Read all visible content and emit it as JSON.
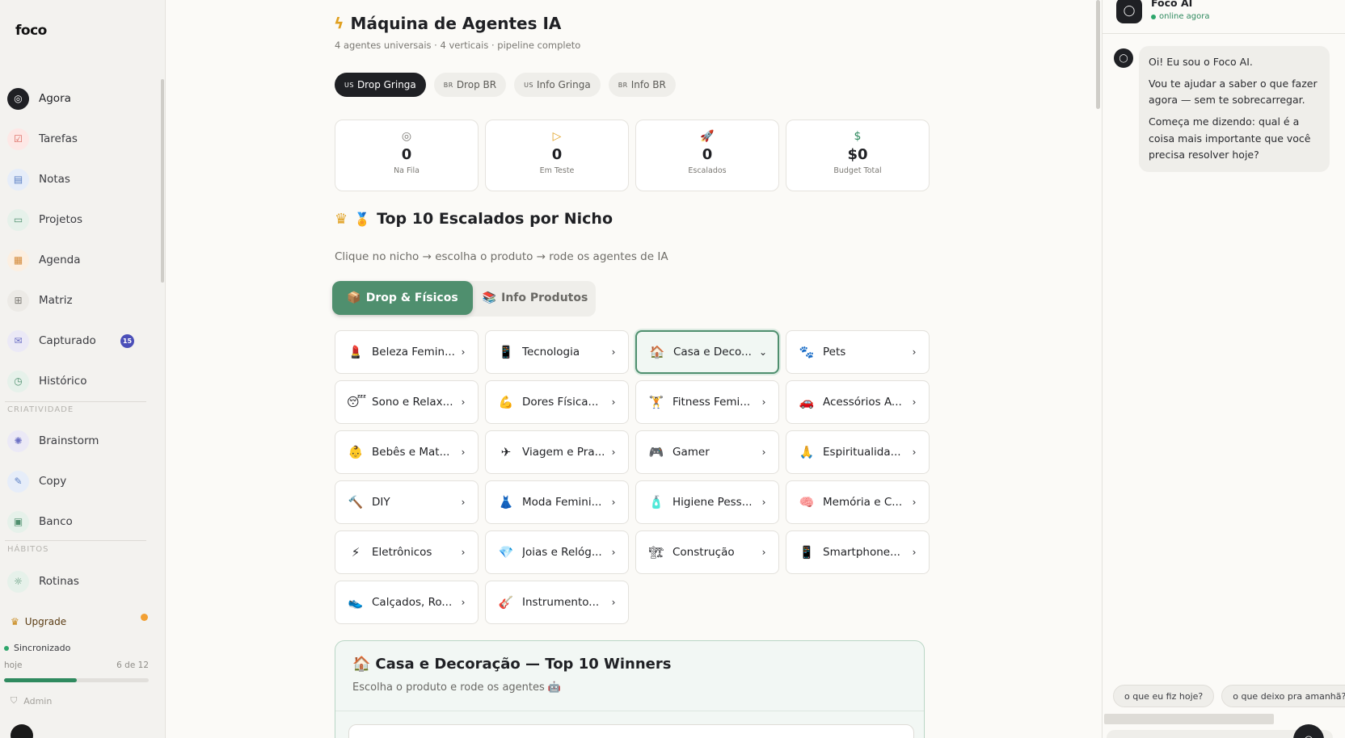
{
  "app": {
    "logo_text": "foco"
  },
  "sidebar": {
    "items": [
      {
        "label": "Agora",
        "icon": "◎",
        "icon_name": "target-icon",
        "bg": "#1f2024",
        "color": "#ffffff",
        "active": true
      },
      {
        "label": "Tarefas",
        "icon": "☑",
        "icon_name": "checkbox-icon",
        "bg": "#fde8e6",
        "color": "#d9645a"
      },
      {
        "label": "Notas",
        "icon": "▤",
        "icon_name": "note-icon",
        "bg": "#e6edf9",
        "color": "#5b7fc4"
      },
      {
        "label": "Projetos",
        "icon": "▭",
        "icon_name": "folder-icon",
        "bg": "#e6f1ea",
        "color": "#4f8f6e"
      },
      {
        "label": "Agenda",
        "icon": "▦",
        "icon_name": "calendar-icon",
        "bg": "#fcefe1",
        "color": "#d48a3a"
      },
      {
        "label": "Matriz",
        "icon": "⊞",
        "icon_name": "grid-icon",
        "bg": "#eceae6",
        "color": "#7a7873"
      },
      {
        "label": "Capturado",
        "icon": "✉",
        "icon_name": "inbox-icon",
        "bg": "#ebe9f6",
        "color": "#6b6fc4",
        "badge": "15"
      },
      {
        "label": "Histórico",
        "icon": "◷",
        "icon_name": "clock-icon",
        "bg": "#e6f1ea",
        "color": "#4f8f6e"
      }
    ],
    "criatividade_label": "CRIATIVIDADE",
    "criatividade_items": [
      {
        "label": "Brainstorm",
        "icon": "✺",
        "icon_name": "sparkle-icon",
        "bg": "#ebe9f6",
        "color": "#6b6fc4"
      },
      {
        "label": "Copy",
        "icon": "✎",
        "icon_name": "pen-icon",
        "bg": "#e6edf9",
        "color": "#5b7fc4"
      },
      {
        "label": "Banco",
        "icon": "▣",
        "icon_name": "archive-icon",
        "bg": "#e6f1ea",
        "color": "#4f8f6e"
      }
    ],
    "habitos_label": "HÁBITOS",
    "habitos_items": [
      {
        "label": "Rotinas",
        "icon": "☼",
        "icon_name": "sun-icon",
        "bg": "#e6f1ea",
        "color": "#4f8f6e"
      }
    ],
    "upgrade_label": "Upgrade",
    "sync_label": "Sincronizado",
    "progress_left": "hoje",
    "progress_right": "6 de 12",
    "progress_fraction": 0.5,
    "admin_label": "Admin"
  },
  "main": {
    "title": "Máquina de Agentes IA",
    "subtitle": "4 agentes universais · 4 verticais · pipeline completo",
    "pills": [
      {
        "code": "US",
        "label": "Drop Gringa",
        "active": true
      },
      {
        "code": "BR",
        "label": "Drop BR"
      },
      {
        "code": "US",
        "label": "Info Gringa"
      },
      {
        "code": "BR",
        "label": "Info BR"
      }
    ],
    "stats": [
      {
        "icon": "◎",
        "icon_name": "target-icon",
        "color": "#7a7873",
        "value": "0",
        "label": "Na Fila"
      },
      {
        "icon": "▷",
        "icon_name": "play-icon",
        "color": "#e0a020",
        "value": "0",
        "label": "Em Teste"
      },
      {
        "icon": "🚀",
        "icon_name": "rocket-icon",
        "color": "#2f8a5f",
        "value": "0",
        "label": "Escalados"
      },
      {
        "icon": "$",
        "icon_name": "dollar-icon",
        "color": "#2f8a5f",
        "value": "$0",
        "label": "Budget Total"
      }
    ],
    "section_title": "Top 10 Escalados por Nicho",
    "section_emoji": "🏅",
    "section_desc": "Clique no nicho → escolha o produto → rode os agentes de IA",
    "tabs": [
      {
        "emoji": "📦",
        "label": "Drop & Físicos",
        "active": true
      },
      {
        "emoji": "📚",
        "label": "Info Produtos"
      }
    ],
    "niches": [
      {
        "emoji": "💄",
        "label": "Beleza Femin..."
      },
      {
        "emoji": "📱",
        "label": "Tecnologia"
      },
      {
        "emoji": "🏠",
        "label": "Casa e Deco...",
        "selected": true
      },
      {
        "emoji": "🐾",
        "label": "Pets"
      },
      {
        "emoji": "😴",
        "label": "Sono e Relax..."
      },
      {
        "emoji": "💪",
        "label": "Dores Física..."
      },
      {
        "emoji": "🏋",
        "label": "Fitness Femi..."
      },
      {
        "emoji": "🚗",
        "label": "Acessórios A..."
      },
      {
        "emoji": "👶",
        "label": "Bebês e Mat..."
      },
      {
        "emoji": "✈",
        "label": "Viagem e Pra..."
      },
      {
        "emoji": "🎮",
        "label": "Gamer"
      },
      {
        "emoji": "🙏",
        "label": "Espiritualida..."
      },
      {
        "emoji": "🔨",
        "label": "DIY"
      },
      {
        "emoji": "👗",
        "label": "Moda Femini..."
      },
      {
        "emoji": "🧴",
        "label": "Higiene Pess..."
      },
      {
        "emoji": "🧠",
        "label": "Memória e C..."
      },
      {
        "emoji": "⚡",
        "label": "Eletrônicos"
      },
      {
        "emoji": "💎",
        "label": "Joias e Relóg..."
      },
      {
        "emoji": "🏗",
        "label": "Construção"
      },
      {
        "emoji": "📱",
        "label": "Smartphone..."
      },
      {
        "emoji": "👟",
        "label": "Calçados, Ro..."
      },
      {
        "emoji": "🎸",
        "label": "Instrumento..."
      }
    ],
    "winners": {
      "emoji": "🏠",
      "title": "Casa e Decoração — Top 10 Winners",
      "subtitle": "Escolha o produto e rode os agentes 🤖"
    }
  },
  "chat": {
    "name": "Foco AI",
    "status": "online agora",
    "messages": [
      "Oi! Eu sou o Foco AI.",
      "Vou te ajudar a saber o que fazer agora — sem te sobrecarregar.",
      "Começa me dizendo: qual é a coisa mais importante que você precisa resolver hoje?"
    ],
    "suggestions": [
      "o que eu fiz hoje?",
      "o que deixo pra amanhã?"
    ]
  }
}
